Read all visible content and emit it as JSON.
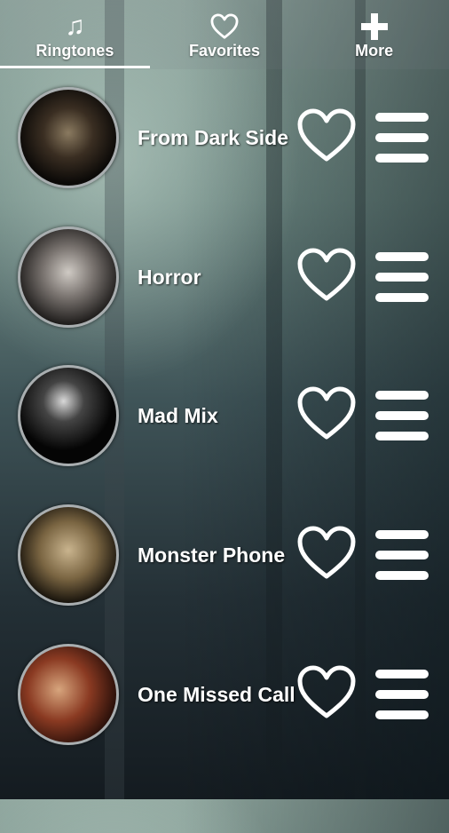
{
  "tabs": [
    {
      "label": "Ringtones",
      "icon": "music-note-icon",
      "active": true
    },
    {
      "label": "Favorites",
      "icon": "heart-outline-icon",
      "active": false
    },
    {
      "label": "More",
      "icon": "plus-icon",
      "active": false
    }
  ],
  "ringtones": [
    {
      "title": "From Dark Side",
      "favorite": false
    },
    {
      "title": "Horror",
      "favorite": false
    },
    {
      "title": "Mad Mix",
      "favorite": false
    },
    {
      "title": "Monster Phone",
      "favorite": false
    },
    {
      "title": "One Missed Call",
      "favorite": false
    }
  ]
}
